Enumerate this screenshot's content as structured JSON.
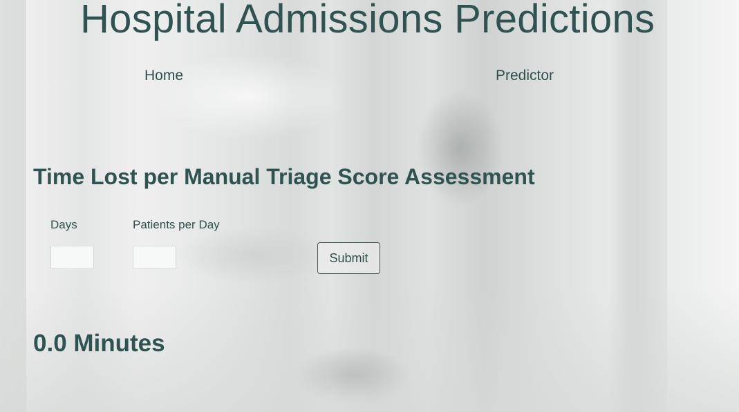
{
  "header": {
    "title": "Hospital Admissions Predictions"
  },
  "nav": {
    "items": [
      {
        "label": "Home"
      },
      {
        "label": "Predictor"
      }
    ]
  },
  "form": {
    "section_title": "Time Lost per Manual Triage Score Assessment",
    "days_label": "Days",
    "days_value": "",
    "patients_label": "Patients per Day",
    "patients_value": "",
    "submit_label": "Submit"
  },
  "result": {
    "text": "0.0 Minutes"
  },
  "colors": {
    "text": "#2f5350",
    "button_border": "#3e5754",
    "input_background": "#f7f8f8"
  }
}
